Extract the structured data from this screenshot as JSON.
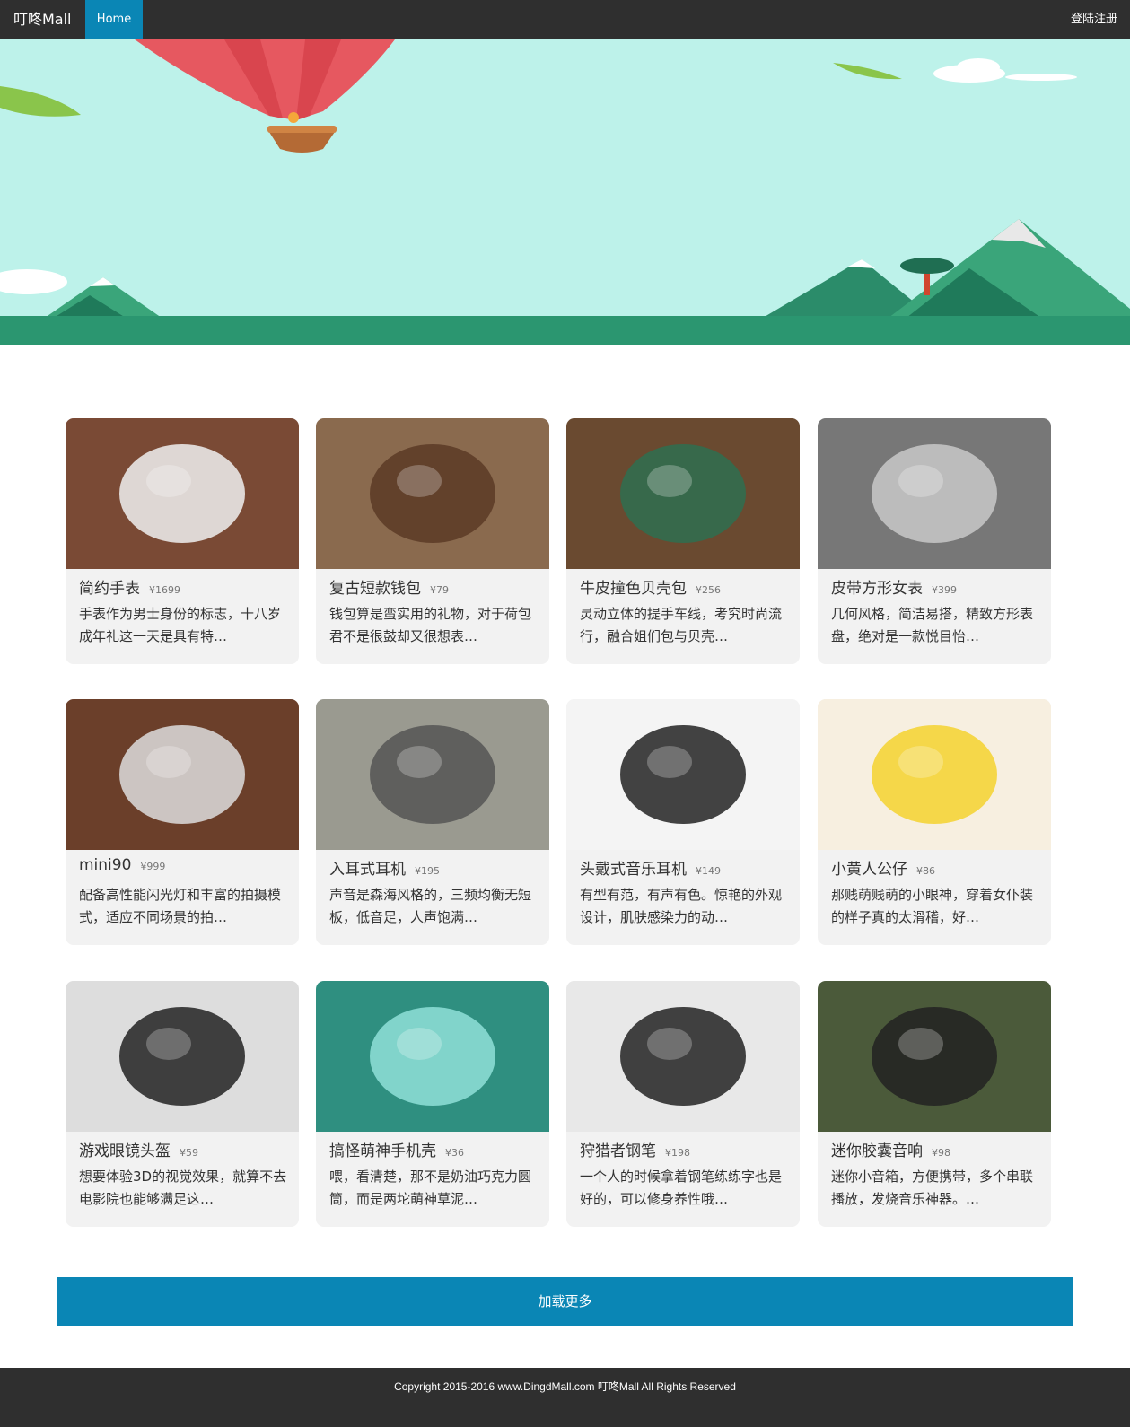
{
  "nav": {
    "brand": "叮咚Mall",
    "home": "Home",
    "login": "登陆注册"
  },
  "products": [
    {
      "name": "简约手表",
      "price": "¥1699",
      "desc": "手表作为男士身份的标志，十八岁成年礼这一天是具有特…"
    },
    {
      "name": "复古短款钱包",
      "price": "¥79",
      "desc": "钱包算是蛮实用的礼物，对于荷包君不是很鼓却又很想表…"
    },
    {
      "name": "牛皮撞色贝壳包",
      "price": "¥256",
      "desc": "灵动立体的提手车线，考究时尚流行，融合姐们包与贝壳…"
    },
    {
      "name": "皮带方形女表",
      "price": "¥399",
      "desc": "几何风格，简洁易搭，精致方形表盘，绝对是一款悦目怡…"
    },
    {
      "name": "mini90",
      "price": "¥999",
      "desc": "配备高性能闪光灯和丰富的拍摄模式，适应不同场景的拍…"
    },
    {
      "name": "入耳式耳机",
      "price": "¥195",
      "desc": "声音是森海风格的，三频均衡无短板，低音足，人声饱满…"
    },
    {
      "name": "头戴式音乐耳机",
      "price": "¥149",
      "desc": "有型有范，有声有色。惊艳的外观设计，肌肤感染力的动…"
    },
    {
      "name": "小黄人公仔",
      "price": "¥86",
      "desc": "那贱萌贱萌的小眼神，穿着女仆装的样子真的太滑稽，好…"
    },
    {
      "name": "游戏眼镜头盔",
      "price": "¥59",
      "desc": "想要体验3D的视觉效果，就算不去电影院也能够满足这…"
    },
    {
      "name": "搞怪萌神手机壳",
      "price": "¥36",
      "desc": "喂，看清楚，那不是奶油巧克力圆筒，而是两坨萌神草泥…"
    },
    {
      "name": "狩猎者钢笔",
      "price": "¥198",
      "desc": "一个人的时候拿着钢笔练练字也是好的，可以修身养性哦…"
    },
    {
      "name": "迷你胶囊音响",
      "price": "¥98",
      "desc": "迷你小音箱，方便携带，多个串联播放，发烧音乐神器。…"
    }
  ],
  "load_more": "加载更多",
  "footer": {
    "copyright": "Copyright 2015-2016 www.DingdMall.com 叮咚Mall All Rights Reserved"
  },
  "colors": {
    "nav_bg": "#2f2f2f",
    "accent": "#0a86b5",
    "banner_sky": "#bdf2ea",
    "card_bg": "#f2f2f2"
  },
  "icons": {
    "thumbs": [
      "watch-image",
      "wallet-image",
      "bag-image",
      "ladies-watch-image",
      "camera-image",
      "earphones-image",
      "headphones-image",
      "minion-toy-image",
      "vr-headset-image",
      "phone-case-image",
      "fountain-pen-image",
      "capsule-speaker-image"
    ]
  }
}
